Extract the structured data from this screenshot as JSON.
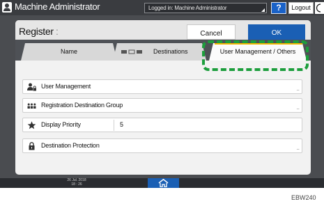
{
  "topbar": {
    "title": "Machine Administrator",
    "login_status": "Logged in: Machine Administrator",
    "help_label": "?",
    "logout_label": "Logout"
  },
  "register": {
    "title": "Register",
    "colon": ":",
    "cancel_label": "Cancel",
    "ok_label": "OK"
  },
  "tabs": {
    "name": "Name",
    "destinations": "Destinations",
    "user_management": "User Management / Others"
  },
  "rows": [
    {
      "label": "User Management",
      "value": "",
      "icon": "user-lock-icon"
    },
    {
      "label": "Registration Destination Group",
      "value": "",
      "icon": "group-icon"
    },
    {
      "label": "Display Priority",
      "value": "5",
      "icon": "star-icon"
    },
    {
      "label": "Destination Protection",
      "value": "",
      "icon": "lock-icon"
    }
  ],
  "more_indicator": "....",
  "bottom": {
    "date": "26 Jul. 2018",
    "time": "18 : 26"
  },
  "footer_code": "EBW240",
  "colors": {
    "accent_blue": "#1a5fb4",
    "tab_highlight": "#f0b800",
    "callout_green": "#1c9e3c"
  }
}
